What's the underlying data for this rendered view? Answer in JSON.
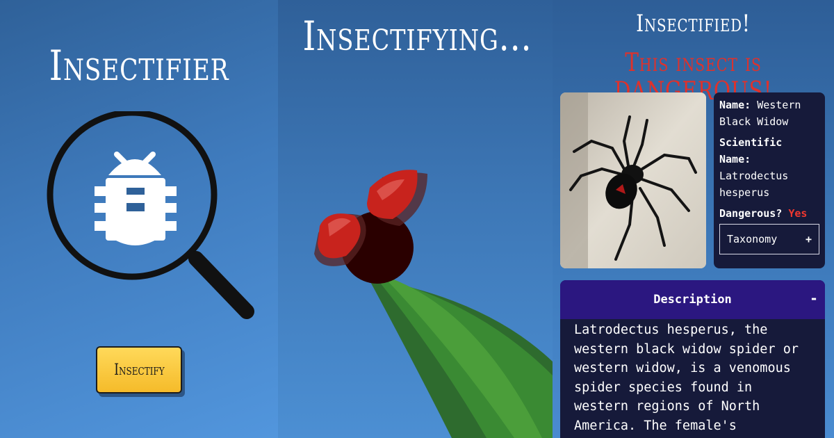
{
  "screen_1": {
    "title": "Insectifier",
    "button_label": "Insectify",
    "icon": "magnifier-bug-icon"
  },
  "screen_2": {
    "title": "Insectifying...",
    "scene": "ladybug-on-leaf"
  },
  "screen_3": {
    "title": "Insectified!",
    "danger_message": "This insect is DANGEROUS!",
    "photo_icon": "spider-photo",
    "info": {
      "name_label": "Name:",
      "name_value": "Western Black Widow",
      "scientific_label": "Scientific Name:",
      "scientific_value": "Latrodectus hesperus",
      "dangerous_label": "Dangerous?",
      "dangerous_value": "Yes",
      "taxonomy_label": "Taxonomy",
      "taxonomy_toggle": "+"
    },
    "description": {
      "header": "Description",
      "toggle": "-",
      "text": "Latrodectus hesperus, the western black widow spider or western widow, is a venomous spider species found in western regions of North America. The female's"
    }
  },
  "colors": {
    "danger": "#e0312b",
    "card_bg": "#161a3a",
    "header_bg": "#2b1780",
    "button": "#f5bb2a"
  }
}
